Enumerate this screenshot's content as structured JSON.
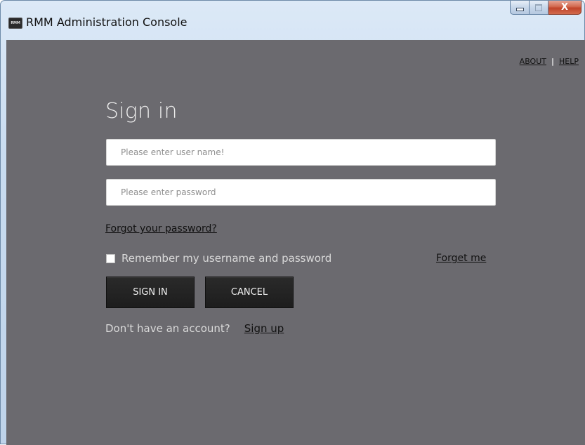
{
  "window": {
    "title": "RMM Administration Console",
    "icon_text": "RMM",
    "controls": {
      "minimize": "minimize",
      "maximize": "maximize",
      "close": "X"
    }
  },
  "header_links": {
    "about": "ABOUT",
    "help": "HELP"
  },
  "form": {
    "title": "Sign in",
    "username": {
      "value": "",
      "placeholder": "Please enter user name!"
    },
    "password": {
      "value": "",
      "placeholder": "Please enter password"
    },
    "forgot_password_link": "Forgot your password?",
    "remember": {
      "label": "Remember my username and password",
      "checked": false
    },
    "forget_me_link": "Forget me",
    "sign_in_button": "SIGN IN",
    "cancel_button": "CANCEL",
    "signup_prompt": "Don't have an account?",
    "signup_link": "Sign up"
  },
  "colors": {
    "client_background": "#6b6a6f",
    "button_background": "#1f1f1f",
    "close_button": "#c9553b",
    "frame": "#c9dcf0"
  }
}
